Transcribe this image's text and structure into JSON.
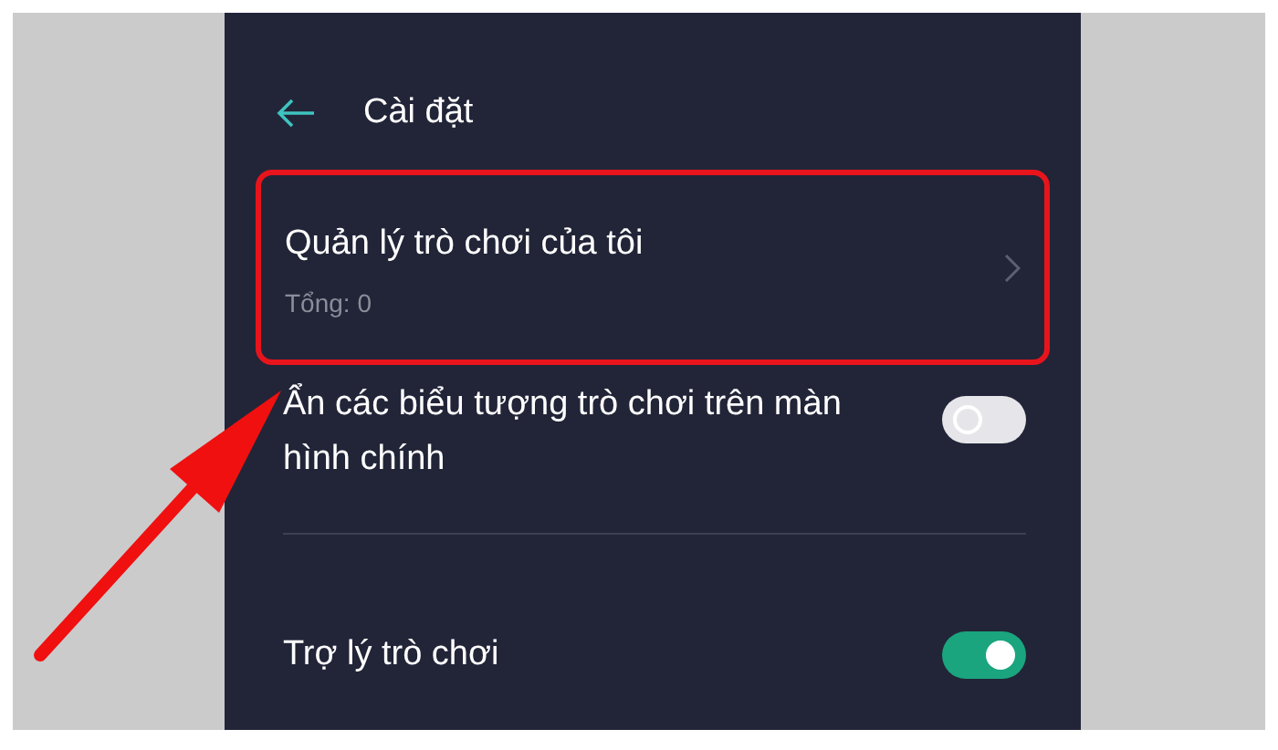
{
  "header": {
    "title": "Cài đặt"
  },
  "items": [
    {
      "kind": "link",
      "title": "Quản lý trò chơi của tôi",
      "subtitle": "Tổng: 0",
      "highlighted": true
    },
    {
      "kind": "toggle",
      "title": "Ẩn các biểu tượng trò chơi trên màn hình chính",
      "on": false,
      "highlighted": false
    },
    {
      "kind": "toggle",
      "title": "Trợ lý trò chơi",
      "on": true,
      "highlighted": false
    }
  ]
}
